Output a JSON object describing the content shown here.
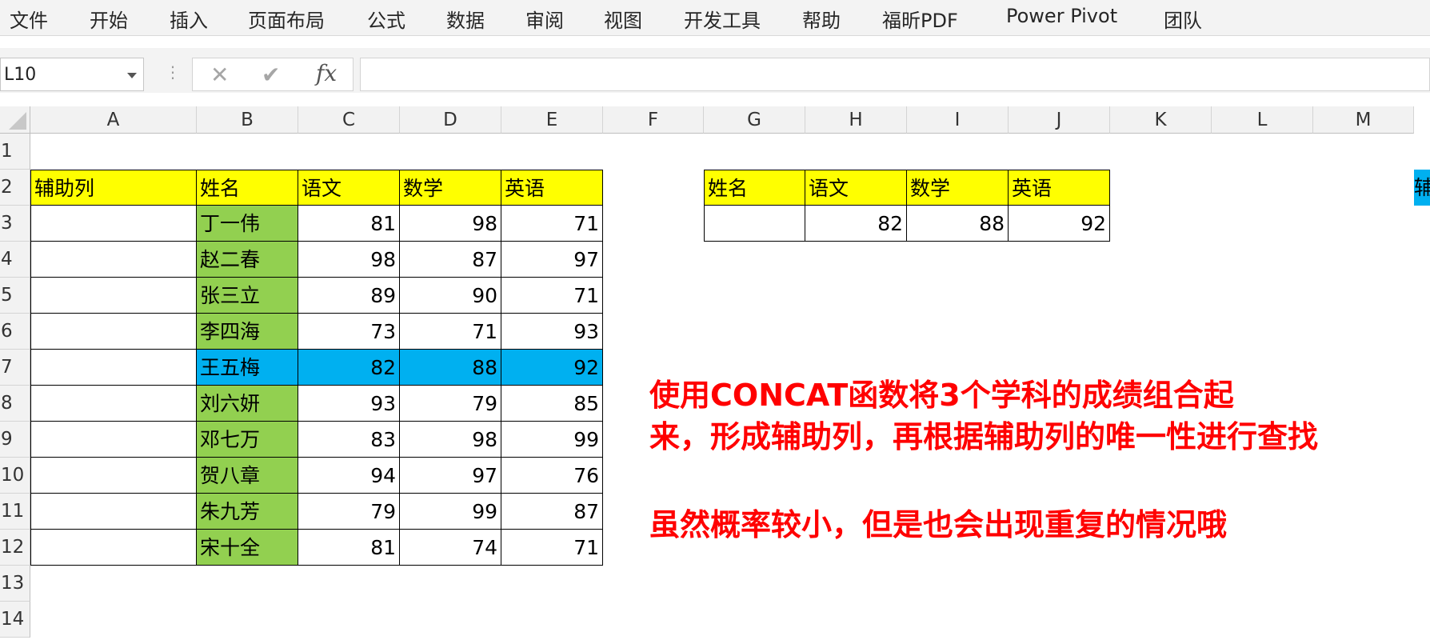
{
  "ribbon": {
    "tabs": [
      "文件",
      "开始",
      "插入",
      "页面布局",
      "公式",
      "数据",
      "审阅",
      "视图",
      "开发工具",
      "帮助",
      "福昕PDF",
      "Power Pivot",
      "团队"
    ]
  },
  "formula_bar": {
    "name_box": "L10",
    "cancel_icon": "✕",
    "enter_icon": "✔",
    "fx_label": "fx",
    "formula": ""
  },
  "columns": [
    "A",
    "B",
    "C",
    "D",
    "E",
    "F",
    "G",
    "H",
    "I",
    "J",
    "K",
    "L",
    "M"
  ],
  "rows": [
    "1",
    "2",
    "3",
    "4",
    "5",
    "6",
    "7",
    "8",
    "9",
    "10",
    "11",
    "12",
    "13",
    "14"
  ],
  "main_table": {
    "headers": [
      "辅助列",
      "姓名",
      "语文",
      "数学",
      "英语"
    ],
    "rows": [
      {
        "helper": "",
        "name": "丁一伟",
        "chinese": "81",
        "math": "98",
        "english": "71"
      },
      {
        "helper": "",
        "name": "赵二春",
        "chinese": "98",
        "math": "87",
        "english": "97"
      },
      {
        "helper": "",
        "name": "张三立",
        "chinese": "89",
        "math": "90",
        "english": "71"
      },
      {
        "helper": "",
        "name": "李四海",
        "chinese": "73",
        "math": "71",
        "english": "93"
      },
      {
        "helper": "",
        "name": "王五梅",
        "chinese": "82",
        "math": "88",
        "english": "92"
      },
      {
        "helper": "",
        "name": "刘六妍",
        "chinese": "93",
        "math": "79",
        "english": "85"
      },
      {
        "helper": "",
        "name": "邓七万",
        "chinese": "83",
        "math": "98",
        "english": "99"
      },
      {
        "helper": "",
        "name": "贺八章",
        "chinese": "94",
        "math": "97",
        "english": "76"
      },
      {
        "helper": "",
        "name": "朱九芳",
        "chinese": "79",
        "math": "99",
        "english": "87"
      },
      {
        "helper": "",
        "name": "宋十全",
        "chinese": "81",
        "math": "74",
        "english": "71"
      }
    ],
    "highlight_row_index": 4
  },
  "lookup_table": {
    "headers": [
      "姓名",
      "语文",
      "数学",
      "英语"
    ],
    "values": [
      "",
      "82",
      "88",
      "92"
    ]
  },
  "right_edge_cell": "辅",
  "annotations": {
    "line1": "使用CONCAT函数将3个学科的成绩组合起",
    "line2": "来，形成辅助列，再根据辅助列的唯一性进行查找",
    "line3": "虽然概率较小，但是也会出现重复的情况哦"
  },
  "colors": {
    "header_fill": "#ffff00",
    "name_fill": "#92d050",
    "highlight_fill": "#00b0f0",
    "annotation_text": "#ff0000"
  }
}
